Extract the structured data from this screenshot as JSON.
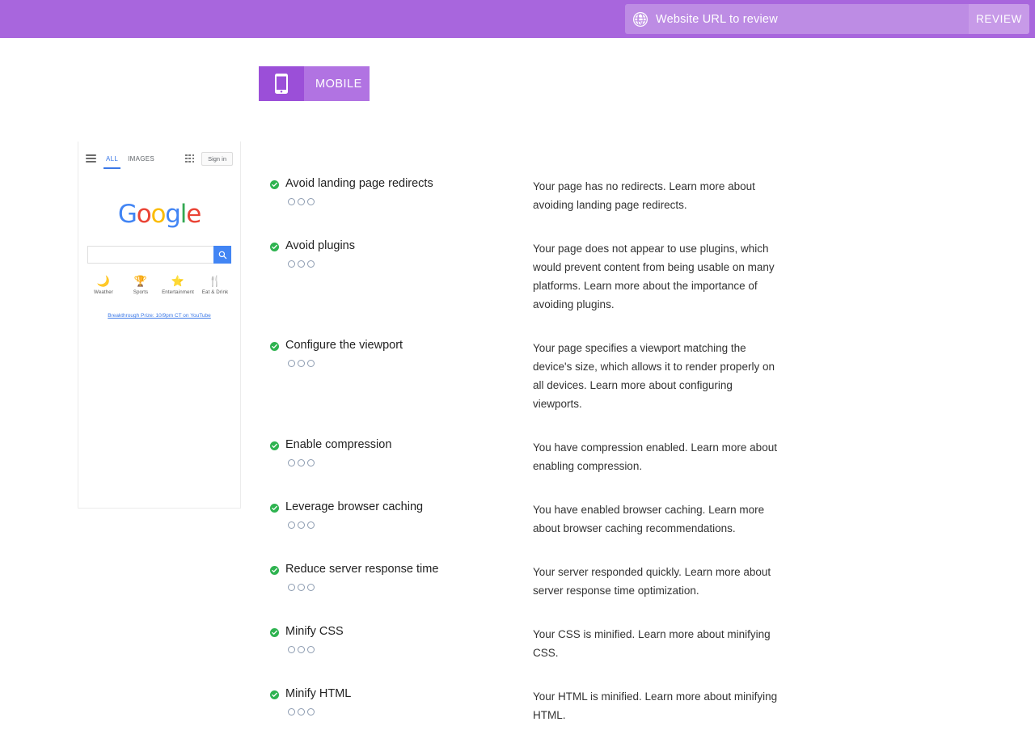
{
  "header": {
    "globe_icon": "globe-icon",
    "url_placeholder": "Website URL to review",
    "url_value": "",
    "review_label": "REVIEW",
    "bar_color": "#a866dd",
    "input_color": "#bd8ce4",
    "button_color": "#c79ae8"
  },
  "tabs": [
    {
      "label": "MOBILE",
      "icon": "mobile-phone-icon",
      "active": true,
      "icon_bg": "#9b4fd8",
      "label_bg": "#b173e2"
    }
  ],
  "preview": {
    "nav": {
      "menu_icon": "hamburger-menu-icon",
      "all_label": "ALL",
      "images_label": "IMAGES",
      "apps_icon": "apps-grid-icon",
      "signin_label": "Sign in"
    },
    "logo": {
      "letters": [
        {
          "char": "G",
          "color": "#4285f4"
        },
        {
          "char": "o",
          "color": "#ea4335"
        },
        {
          "char": "o",
          "color": "#fbbc05"
        },
        {
          "char": "g",
          "color": "#4285f4"
        },
        {
          "char": "l",
          "color": "#34a853"
        },
        {
          "char": "e",
          "color": "#ea4335"
        }
      ]
    },
    "search": {
      "value": "",
      "placeholder": "",
      "button_icon": "search-icon"
    },
    "shortcuts": [
      {
        "label": "Weather",
        "icon": "🌙"
      },
      {
        "label": "Sports",
        "icon": "🏆"
      },
      {
        "label": "Entertainment",
        "icon": "⭐"
      },
      {
        "label": "Eat & Drink",
        "icon": "🍴"
      }
    ],
    "promo_link": "Breakthrough Prize: 10/9pm CT on YouTube"
  },
  "audits": [
    {
      "title": "Avoid landing page redirects",
      "status_icon": "check-circle-icon",
      "status_color": "#2eb350",
      "rating_dots": 3,
      "rating_filled": 0,
      "description": "Your page has no redirects. Learn more about avoiding landing page redirects."
    },
    {
      "title": "Avoid plugins",
      "status_icon": "check-circle-icon",
      "status_color": "#2eb350",
      "rating_dots": 3,
      "rating_filled": 0,
      "description": "Your page does not appear to use plugins, which would prevent content from being usable on many platforms. Learn more about the importance of avoiding plugins."
    },
    {
      "title": "Configure the viewport",
      "status_icon": "check-circle-icon",
      "status_color": "#2eb350",
      "rating_dots": 3,
      "rating_filled": 0,
      "description": "Your page specifies a viewport matching the device's size, which allows it to render properly on all devices. Learn more about configuring viewports."
    },
    {
      "title": "Enable compression",
      "status_icon": "check-circle-icon",
      "status_color": "#2eb350",
      "rating_dots": 3,
      "rating_filled": 0,
      "description": "You have compression enabled. Learn more about enabling compression."
    },
    {
      "title": "Leverage browser caching",
      "status_icon": "check-circle-icon",
      "status_color": "#2eb350",
      "rating_dots": 3,
      "rating_filled": 0,
      "description": "You have enabled browser caching. Learn more about browser caching recommendations."
    },
    {
      "title": "Reduce server response time",
      "status_icon": "check-circle-icon",
      "status_color": "#2eb350",
      "rating_dots": 3,
      "rating_filled": 0,
      "description": "Your server responded quickly. Learn more about server response time optimization."
    },
    {
      "title": "Minify CSS",
      "status_icon": "check-circle-icon",
      "status_color": "#2eb350",
      "rating_dots": 3,
      "rating_filled": 0,
      "description": "Your CSS is minified. Learn more about minifying CSS."
    },
    {
      "title": "Minify HTML",
      "status_icon": "check-circle-icon",
      "status_color": "#2eb350",
      "rating_dots": 3,
      "rating_filled": 0,
      "description": "Your HTML is minified. Learn more about minifying HTML."
    }
  ]
}
